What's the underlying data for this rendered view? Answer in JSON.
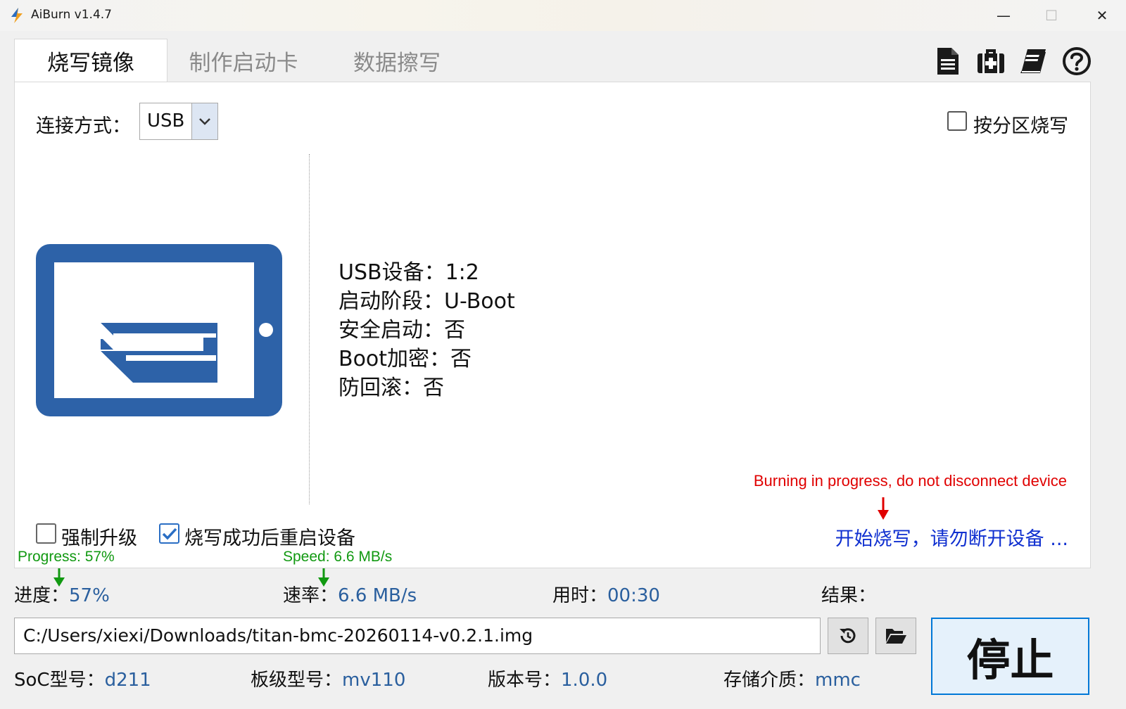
{
  "window": {
    "title": "AiBurn v1.4.7",
    "minimize": "—",
    "maximize": "☐",
    "close": "✕"
  },
  "tabs": [
    {
      "label": "烧写镜像",
      "active": true
    },
    {
      "label": "制作启动卡",
      "active": false
    },
    {
      "label": "数据擦写",
      "active": false
    }
  ],
  "toolbar_icons": [
    "document-icon",
    "medical-kit-icon",
    "book-icon",
    "help-icon"
  ],
  "connection": {
    "label": "连接方式：",
    "selected": "USB"
  },
  "partition_burn": {
    "label": "按分区烧写",
    "checked": false
  },
  "device_info": {
    "usb_device": "USB设备：1:2",
    "boot_stage": "启动阶段：U-Boot",
    "secure_boot": "安全启动：否",
    "boot_encrypt": "Boot加密：否",
    "anti_rollback": "防回滚：否"
  },
  "annotations": {
    "warning": "Burning in progress, do not disconnect device",
    "progress": "Progress: 57%",
    "speed": "Speed: 6.6 MB/s"
  },
  "burn_status": "开始烧写，请勿断开设备 ...",
  "options": {
    "force_upgrade": {
      "label": "强制升级",
      "checked": false
    },
    "reboot_after": {
      "label": "烧写成功后重启设备",
      "checked": true
    }
  },
  "stats": {
    "progress_label": "进度：",
    "progress_value": "57%",
    "speed_label": "速率：",
    "speed_value": "6.6 MB/s",
    "time_label": "用时：",
    "time_value": "00:30",
    "result_label": "结果：",
    "result_value": ""
  },
  "image_path": "C:/Users/xiexi/Downloads/titan-bmc-20260114-v0.2.1.img",
  "stop_button": "停止",
  "meta": {
    "soc_label": "SoC型号：",
    "soc_value": "d211",
    "board_label": "板级型号：",
    "board_value": "mv110",
    "version_label": "版本号：",
    "version_value": "1.0.0",
    "storage_label": "存储介质：",
    "storage_value": "mmc"
  },
  "colors": {
    "accent_blue": "#2a5f9e",
    "device_icon": "#2d62a8",
    "warning_red": "#e00000",
    "status_blue": "#1030d0",
    "annotation_green": "#119911"
  }
}
